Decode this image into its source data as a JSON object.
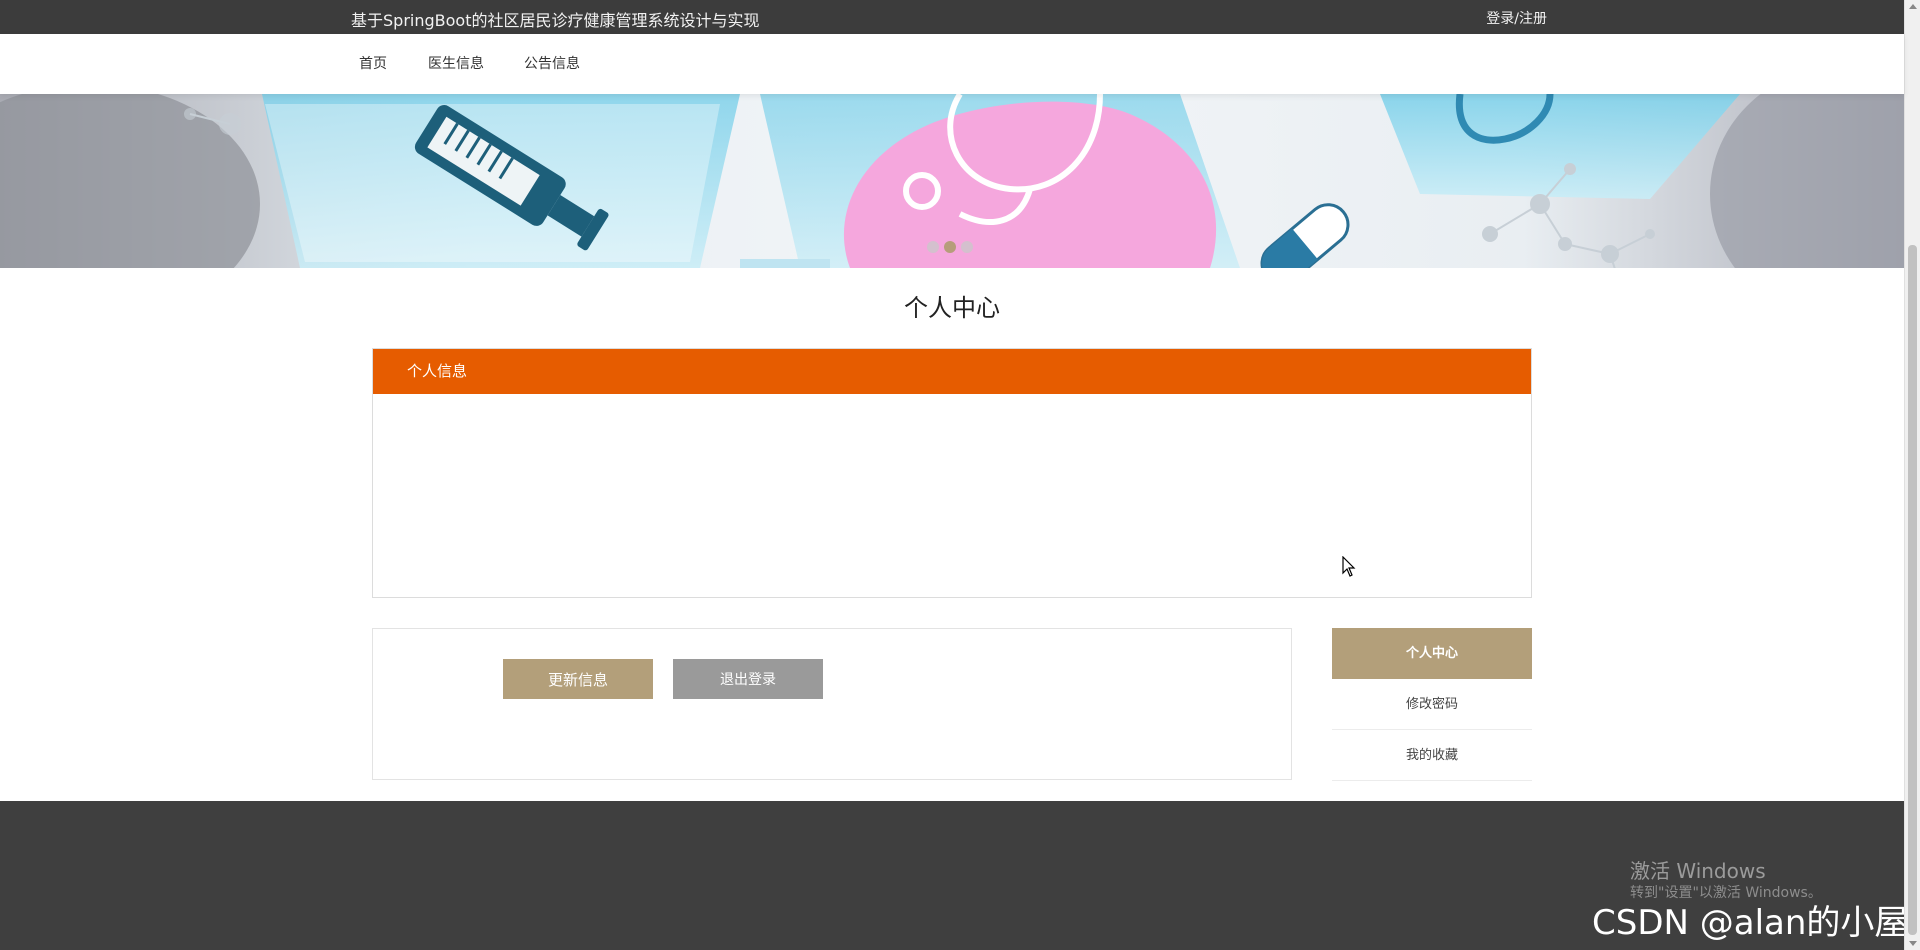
{
  "header": {
    "site_title": "基于SpringBoot的社区居民诊疗健康管理系统设计与实现",
    "login_register": "登录/注册"
  },
  "nav": {
    "items": [
      {
        "label": "首页"
      },
      {
        "label": "医生信息"
      },
      {
        "label": "公告信息"
      }
    ]
  },
  "banner": {
    "slide_count": 3,
    "active_slide": 2
  },
  "page": {
    "title": "个人中心"
  },
  "info_panel": {
    "header": "个人信息"
  },
  "actions": {
    "update_label": "更新信息",
    "logout_label": "退出登录"
  },
  "side_menu": {
    "items": [
      {
        "label": "个人中心",
        "active": true
      },
      {
        "label": "修改密码",
        "active": false
      },
      {
        "label": "我的收藏",
        "active": false
      }
    ]
  },
  "watermark": {
    "activate_title": "激活 Windows",
    "activate_hint": "转到\"设置\"以激活 Windows。",
    "csdn": "CSDN @alan的小屋"
  },
  "colors": {
    "topbar": "#3c3c3c",
    "accent_orange": "#e65c00",
    "accent_gold": "#b39f7a",
    "button_gray": "#9a9a9a",
    "footer": "#3f3f3f"
  }
}
